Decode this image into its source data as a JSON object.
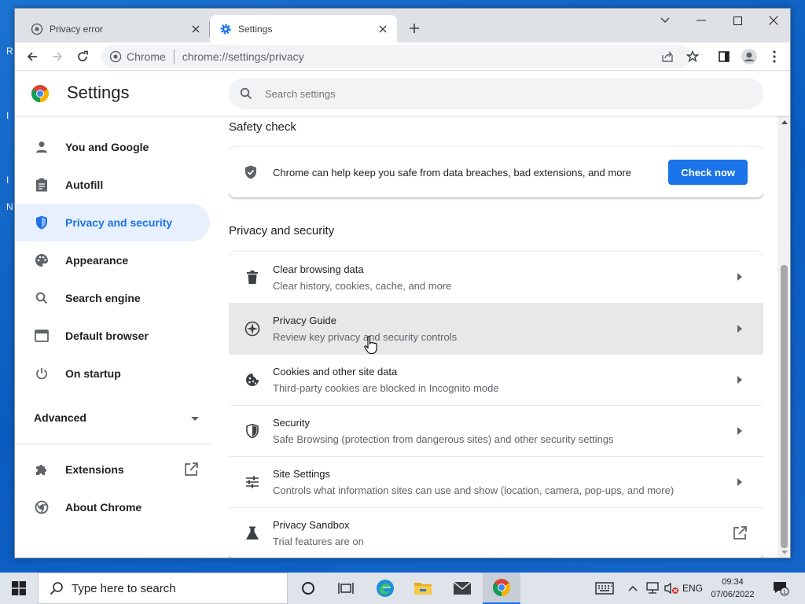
{
  "colors": {
    "accent": "#1a73e8",
    "active_nav_bg": "#e8f0fe",
    "tab_strip": "#dee1e6",
    "hover_row": "#e8e8e8"
  },
  "desktop": {
    "fragments": [
      "R",
      "I",
      "I",
      "N"
    ]
  },
  "tabs": [
    {
      "title": "Privacy error",
      "icon": "globe-icon",
      "active": false
    },
    {
      "title": "Settings",
      "icon": "gear-icon",
      "active": true
    }
  ],
  "toolbar": {
    "site_label": "Chrome",
    "url": "chrome://settings/privacy"
  },
  "header": {
    "title": "Settings",
    "search_placeholder": "Search settings"
  },
  "sidebar": {
    "items": [
      {
        "label": "You and Google",
        "icon": "person-icon"
      },
      {
        "label": "Autofill",
        "icon": "clipboard-icon"
      },
      {
        "label": "Privacy and security",
        "icon": "shield-icon",
        "active": true
      },
      {
        "label": "Appearance",
        "icon": "palette-icon"
      },
      {
        "label": "Search engine",
        "icon": "search-icon"
      },
      {
        "label": "Default browser",
        "icon": "browser-window-icon"
      },
      {
        "label": "On startup",
        "icon": "power-icon"
      }
    ],
    "advanced_label": "Advanced",
    "extensions_label": "Extensions",
    "about_label": "About Chrome"
  },
  "main": {
    "safety_check": {
      "title": "Safety check",
      "text": "Chrome can help keep you safe from data breaches, bad extensions, and more",
      "button": "Check now"
    },
    "privacy": {
      "title": "Privacy and security",
      "rows": [
        {
          "title": "Clear browsing data",
          "subtitle": "Clear history, cookies, cache, and more",
          "icon": "trash-icon"
        },
        {
          "title": "Privacy Guide",
          "subtitle": "Review key privacy and security controls",
          "icon": "compass-icon"
        },
        {
          "title": "Cookies and other site data",
          "subtitle": "Third-party cookies are blocked in Incognito mode",
          "icon": "cookie-icon"
        },
        {
          "title": "Security",
          "subtitle": "Safe Browsing (protection from dangerous sites) and other security settings",
          "icon": "shield-icon"
        },
        {
          "title": "Site Settings",
          "subtitle": "Controls what information sites can use and show (location, camera, pop-ups, and more)",
          "icon": "sliders-icon"
        },
        {
          "title": "Privacy Sandbox",
          "subtitle": "Trial features are on",
          "icon": "flask-icon"
        }
      ]
    }
  },
  "taskbar": {
    "search_placeholder": "Type here to search",
    "language": "ENG",
    "time": "09:34",
    "date": "07/06/2022",
    "notification_count": "1"
  }
}
